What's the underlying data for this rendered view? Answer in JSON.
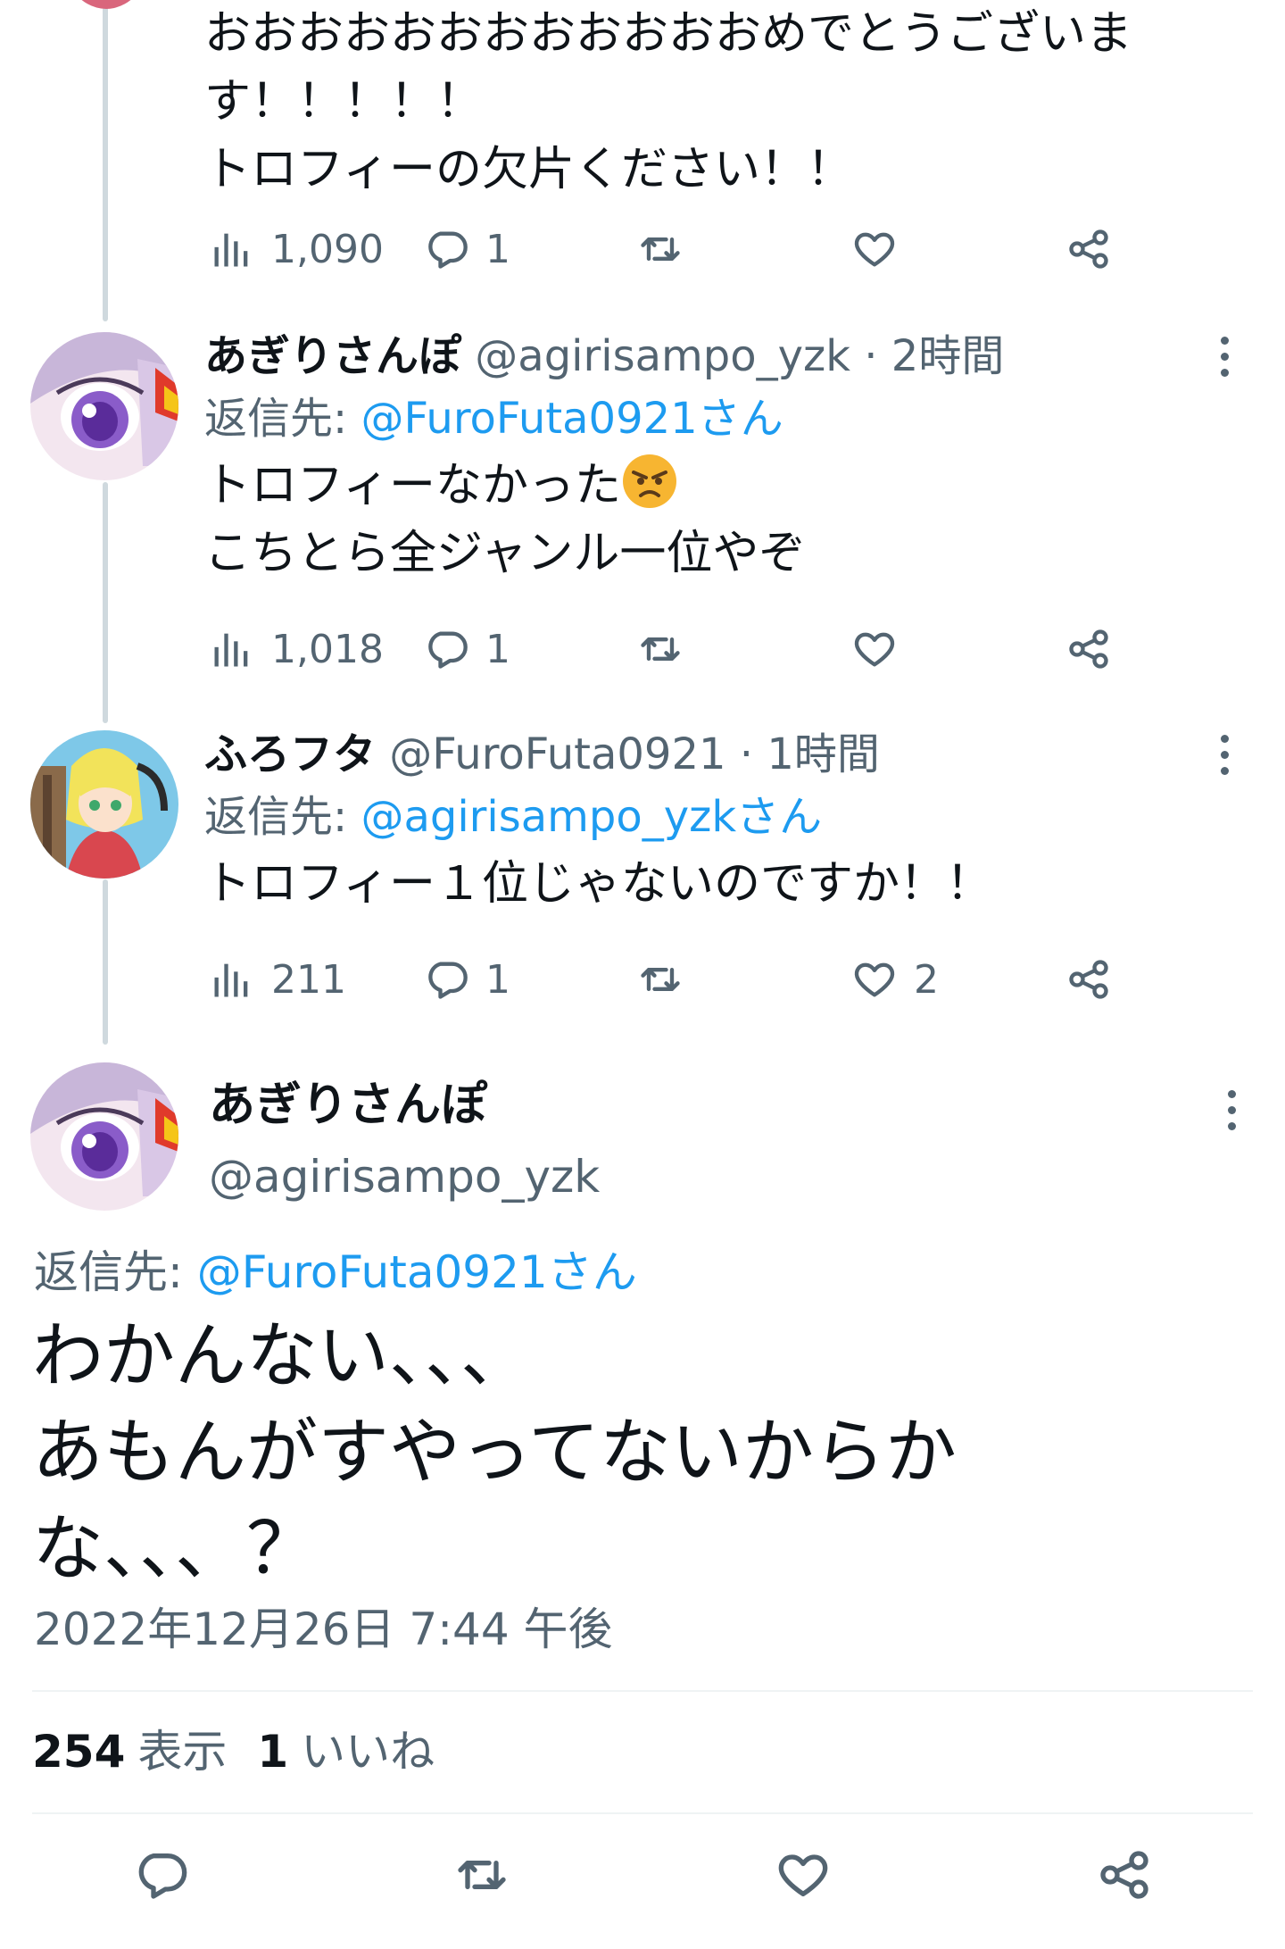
{
  "tweets": [
    {
      "body_lines": [
        "おおおおおおおおおおおおめでとうございま",
        "す！！！！！",
        "トロフィーの欠片ください！！"
      ],
      "views": "1,090",
      "replies": "1",
      "retweets": "",
      "likes": ""
    },
    {
      "name": "あぎりさんぽ",
      "handle": "@agirisampo_yzk",
      "dot": "·",
      "time": "2時間",
      "reply_prefix": "返信先: ",
      "reply_mention": "@FuroFuta0921さん",
      "body_lines": [
        "トロフィーなかった",
        "こちとら全ジャンル一位やぞ"
      ],
      "emoji": "angry-face",
      "views": "1,018",
      "replies": "1",
      "retweets": "",
      "likes": ""
    },
    {
      "name": "ふろフタ",
      "handle": "@FuroFuta0921",
      "dot": "·",
      "time": "1時間",
      "reply_prefix": "返信先: ",
      "reply_mention": "@agirisampo_yzkさん",
      "body_lines": [
        "トロフィー１位じゃないのですか！！"
      ],
      "views": "211",
      "replies": "1",
      "retweets": "",
      "likes": "2"
    }
  ],
  "main_tweet": {
    "name": "あぎりさんぽ",
    "handle": "@agirisampo_yzk",
    "reply_prefix": "返信先: ",
    "reply_mention": "@FuroFuta0921さん",
    "body_lines": [
      "わかんない、、、",
      "あもんがすやってないからか",
      "な、、、？"
    ],
    "timestamp": "2022年12月26日 7:44 午後",
    "views_count": "254",
    "views_label": "表示",
    "likes_count": "1",
    "likes_label": "いいね"
  },
  "icons": {
    "views": "bar-chart-icon",
    "reply": "speech-bubble-icon",
    "retweet": "retweet-icon",
    "like": "heart-icon",
    "share": "share-icon",
    "more": "more-dots-icon"
  },
  "colors": {
    "text": "#0f1419",
    "secondary": "#536471",
    "link": "#1d9bf0",
    "thread_line": "#cfd9de",
    "divider": "#eff3f4"
  }
}
